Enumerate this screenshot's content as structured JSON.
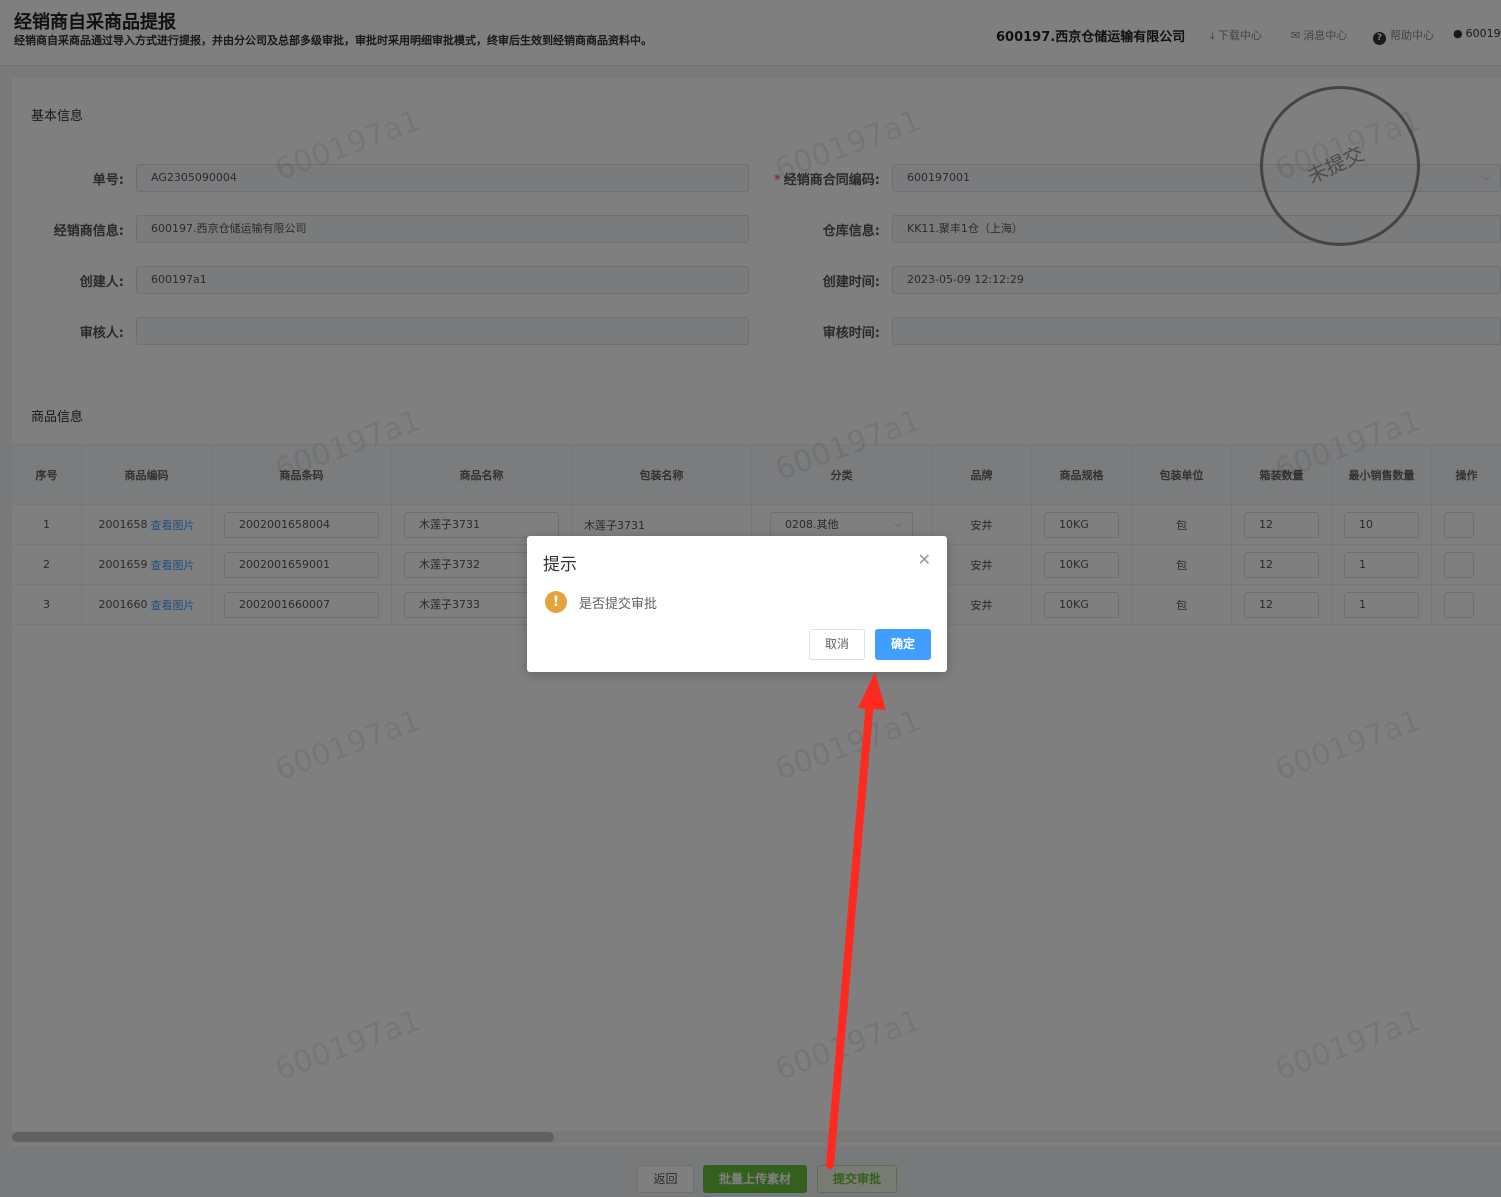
{
  "header": {
    "title": "经销商自采商品提报",
    "description": "经销商自采商品通过导入方式进行提报，并由分公司及总部多级审批，审批时采用明细审批模式，终审后生效到经销商商品资料中。",
    "company": "600197.西京仓储运输有限公司",
    "links": {
      "download": "下载中心",
      "message": "消息中心",
      "help": "帮助中心",
      "user": "60019..."
    }
  },
  "basic": {
    "section_title": "基本信息",
    "order_no_label": "单号:",
    "order_no": "AG2305090004",
    "contract_label": "经销商合同编码:",
    "contract": "600197001",
    "dealer_label": "经销商信息:",
    "dealer": "600197.西京仓储运输有限公司",
    "warehouse_label": "仓库信息:",
    "warehouse": "KK11.聚丰1仓（上海）",
    "creator_label": "创建人:",
    "creator": "600197a1",
    "created_label": "创建时间:",
    "created": "2023-05-09 12:12:29",
    "reviewer_label": "审核人:",
    "reviewer": "",
    "review_time_label": "审核时间:",
    "review_time": ""
  },
  "stamp": "未提交",
  "watermark": "600197a1",
  "goods": {
    "section_title": "商品信息",
    "columns": [
      "序号",
      "商品编码",
      "商品条码",
      "商品名称",
      "包装名称",
      "分类",
      "品牌",
      "商品规格",
      "包装单位",
      "箱装数量",
      "最小销售数量",
      "操作"
    ],
    "view_image": "查看图片",
    "rows": [
      {
        "no": "1",
        "code": "2001658",
        "barcode": "2002001658004",
        "name": "木莲子3731",
        "pack_name": "木莲子3731",
        "category": "0208.其他",
        "brand": "安井",
        "spec": "10KG",
        "unit": "包",
        "box_qty": "12",
        "min_qty": "10"
      },
      {
        "no": "2",
        "code": "2001659",
        "barcode": "2002001659001",
        "name": "木莲子3732",
        "pack_name": "",
        "category": "",
        "brand": "安井",
        "spec": "10KG",
        "unit": "包",
        "box_qty": "12",
        "min_qty": "1"
      },
      {
        "no": "3",
        "code": "2001660",
        "barcode": "2002001660007",
        "name": "木莲子3733",
        "pack_name": "",
        "category": "",
        "brand": "安井",
        "spec": "10KG",
        "unit": "包",
        "box_qty": "12",
        "min_qty": "1"
      }
    ]
  },
  "footer": {
    "back": "返回",
    "batch_upload": "批量上传素材",
    "submit": "提交审批"
  },
  "dialog": {
    "title": "提示",
    "message": "是否提交审批",
    "cancel": "取消",
    "confirm": "确定"
  },
  "colors": {
    "primary": "#409eff",
    "success": "#67c23a",
    "warning": "#e6a23c",
    "arrow": "#ff2a1f"
  }
}
